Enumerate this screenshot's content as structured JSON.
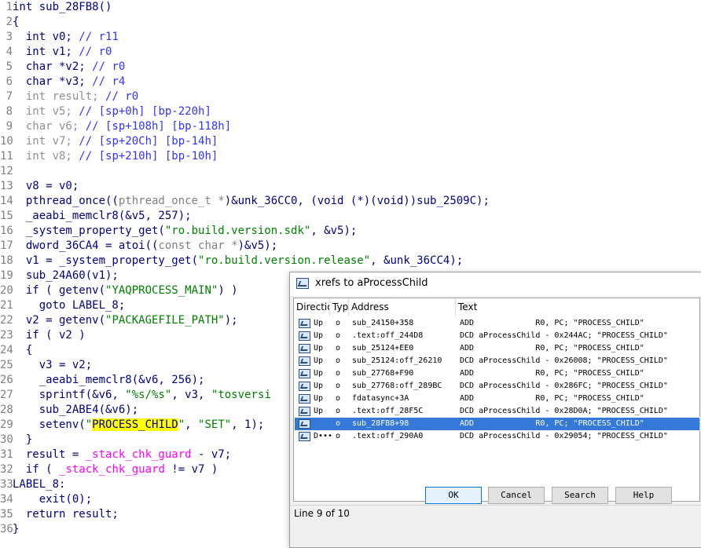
{
  "code_lines": [
    {
      "n": "1",
      "tokens": [
        {
          "t": "int ",
          "c": "kw"
        },
        {
          "t": "sub_28FB8",
          "c": "kw"
        },
        {
          "t": "()",
          "c": "kw"
        }
      ]
    },
    {
      "n": "2",
      "tokens": [
        {
          "t": "{",
          "c": "punc"
        }
      ]
    },
    {
      "n": "3",
      "tokens": [
        {
          "t": "  int v0; ",
          "c": "var"
        },
        {
          "t": "// r11",
          "c": "cmt"
        }
      ]
    },
    {
      "n": "4",
      "tokens": [
        {
          "t": "  int v1; ",
          "c": "var"
        },
        {
          "t": "// r0",
          "c": "cmt"
        }
      ]
    },
    {
      "n": "5",
      "tokens": [
        {
          "t": "  char *v2; ",
          "c": "var"
        },
        {
          "t": "// r0",
          "c": "cmt"
        }
      ]
    },
    {
      "n": "6",
      "tokens": [
        {
          "t": "  char *v3; ",
          "c": "var"
        },
        {
          "t": "// r4",
          "c": "cmt"
        }
      ]
    },
    {
      "n": "7",
      "tokens": [
        {
          "t": "  int result; ",
          "c": "gray"
        },
        {
          "t": "// r0",
          "c": "cmt"
        }
      ]
    },
    {
      "n": "8",
      "tokens": [
        {
          "t": "  int v5; ",
          "c": "gray"
        },
        {
          "t": "// [sp+0h] [bp-220h]",
          "c": "cmt"
        }
      ]
    },
    {
      "n": "9",
      "tokens": [
        {
          "t": "  char v6; ",
          "c": "gray"
        },
        {
          "t": "// [sp+108h] [bp-118h]",
          "c": "cmt"
        }
      ]
    },
    {
      "n": "10",
      "tokens": [
        {
          "t": "  int v7; ",
          "c": "gray"
        },
        {
          "t": "// [sp+20Ch] [bp-14h]",
          "c": "cmt"
        }
      ]
    },
    {
      "n": "11",
      "tokens": [
        {
          "t": "  int v8; ",
          "c": "gray"
        },
        {
          "t": "// [sp+210h] [bp-10h]",
          "c": "cmt"
        }
      ]
    },
    {
      "n": "12",
      "tokens": []
    },
    {
      "n": "13",
      "tokens": [
        {
          "t": "  v8 = v0;",
          "c": "var"
        }
      ]
    },
    {
      "n": "14",
      "tokens": [
        {
          "t": "  pthread_once((",
          "c": "name"
        },
        {
          "t": "pthread_once_t *",
          "c": "dim"
        },
        {
          "t": ")&unk_36CC0, (",
          "c": "name"
        },
        {
          "t": "void (*)(void)",
          "c": "name"
        },
        {
          "t": ")sub_2509C);",
          "c": "name"
        }
      ]
    },
    {
      "n": "15",
      "tokens": [
        {
          "t": "  _aeabi_memclr8(&v5, 257);",
          "c": "name"
        }
      ]
    },
    {
      "n": "16",
      "tokens": [
        {
          "t": "  _system_property_get(",
          "c": "name"
        },
        {
          "t": "\"ro.build.version.sdk\"",
          "c": "str"
        },
        {
          "t": ", &v5);",
          "c": "name"
        }
      ]
    },
    {
      "n": "17",
      "tokens": [
        {
          "t": "  dword_36CA4 = atoi((",
          "c": "name"
        },
        {
          "t": "const char *",
          "c": "dim"
        },
        {
          "t": ")&v5);",
          "c": "name"
        }
      ]
    },
    {
      "n": "18",
      "tokens": [
        {
          "t": "  v1 = _system_property_get(",
          "c": "name"
        },
        {
          "t": "\"ro.build.version.release\"",
          "c": "str"
        },
        {
          "t": ", &unk_36CC4);",
          "c": "name"
        }
      ]
    },
    {
      "n": "19",
      "tokens": [
        {
          "t": "  sub_24A60(v1);",
          "c": "name"
        }
      ]
    },
    {
      "n": "20",
      "tokens": [
        {
          "t": "  if ( getenv(",
          "c": "name"
        },
        {
          "t": "\"YAQPROCESS_MAIN\"",
          "c": "str"
        },
        {
          "t": ") )",
          "c": "name"
        }
      ]
    },
    {
      "n": "21",
      "tokens": [
        {
          "t": "    goto LABEL_8;",
          "c": "name"
        }
      ]
    },
    {
      "n": "22",
      "tokens": [
        {
          "t": "  v2 = getenv(",
          "c": "name"
        },
        {
          "t": "\"PACKAGEFILE_PATH\"",
          "c": "str"
        },
        {
          "t": ");",
          "c": "name"
        }
      ]
    },
    {
      "n": "23",
      "tokens": [
        {
          "t": "  if ( v2 )",
          "c": "name"
        }
      ]
    },
    {
      "n": "24",
      "tokens": [
        {
          "t": "  {",
          "c": "punc"
        }
      ]
    },
    {
      "n": "25",
      "tokens": [
        {
          "t": "    v3 = v2;",
          "c": "name"
        }
      ]
    },
    {
      "n": "26",
      "tokens": [
        {
          "t": "    _aeabi_memclr8(&v6, 256);",
          "c": "name"
        }
      ]
    },
    {
      "n": "27",
      "tokens": [
        {
          "t": "    sprintf(&v6, ",
          "c": "name"
        },
        {
          "t": "\"%s/%s\"",
          "c": "str"
        },
        {
          "t": ", v3, ",
          "c": "name"
        },
        {
          "t": "\"tosversi",
          "c": "str"
        }
      ]
    },
    {
      "n": "28",
      "tokens": [
        {
          "t": "    sub_2ABE4(&v6);",
          "c": "name"
        }
      ]
    },
    {
      "n": "29",
      "tokens": [
        {
          "t": "    setenv(",
          "c": "name"
        },
        {
          "t": "\"",
          "c": "str"
        },
        {
          "t": "PROCESS_CHILD",
          "c": "strhl"
        },
        {
          "t": "\"",
          "c": "str"
        },
        {
          "t": ", ",
          "c": "name"
        },
        {
          "t": "\"SET\"",
          "c": "str"
        },
        {
          "t": ", 1);",
          "c": "name"
        }
      ]
    },
    {
      "n": "30",
      "tokens": [
        {
          "t": "  }",
          "c": "punc"
        }
      ]
    },
    {
      "n": "31",
      "tokens": [
        {
          "t": "  result = ",
          "c": "name"
        },
        {
          "t": "_stack_chk_guard",
          "c": "lib"
        },
        {
          "t": " - v7;",
          "c": "name"
        }
      ]
    },
    {
      "n": "32",
      "tokens": [
        {
          "t": "  if ( ",
          "c": "name"
        },
        {
          "t": "_stack_chk_guard",
          "c": "lib"
        },
        {
          "t": " != v7 )",
          "c": "name"
        }
      ]
    },
    {
      "n": "33",
      "tokens": [
        {
          "t": "LABEL_8:",
          "c": "name"
        }
      ]
    },
    {
      "n": "34",
      "tokens": [
        {
          "t": "    exit(0);",
          "c": "name"
        }
      ]
    },
    {
      "n": "35",
      "tokens": [
        {
          "t": "  return result;",
          "c": "name"
        }
      ]
    },
    {
      "n": "36",
      "tokens": [
        {
          "t": "}",
          "c": "punc"
        }
      ]
    }
  ],
  "dialog": {
    "title": "xrefs to aProcessChild",
    "columns": {
      "direction": "Directio",
      "type": "Typ",
      "address": "Address",
      "text": "Text"
    },
    "rows": [
      {
        "dir": "Up",
        "type": "o",
        "address": "sub_24150+358",
        "text": "ADD             R0, PC; \"PROCESS_CHILD\""
      },
      {
        "dir": "Up",
        "type": "o",
        "address": ".text:off_244D8",
        "text": "DCD aProcessChild - 0x244AC; \"PROCESS_CHILD\""
      },
      {
        "dir": "Up",
        "type": "o",
        "address": "sub_25124+EE0",
        "text": "ADD             R0, PC; \"PROCESS_CHILD\""
      },
      {
        "dir": "Up",
        "type": "o",
        "address": "sub_25124:off_26210",
        "text": "DCD aProcessChild - 0x26008; \"PROCESS_CHILD\""
      },
      {
        "dir": "Up",
        "type": "o",
        "address": "sub_27768+F90",
        "text": "ADD             R0, PC; \"PROCESS_CHILD\""
      },
      {
        "dir": "Up",
        "type": "o",
        "address": "sub_27768:off_289BC",
        "text": "DCD aProcessChild - 0x286FC; \"PROCESS_CHILD\""
      },
      {
        "dir": "Up",
        "type": "o",
        "address": "fdatasync+3A",
        "text": "ADD             R0, PC; \"PROCESS_CHILD\""
      },
      {
        "dir": "Up",
        "type": "o",
        "address": ".text:off_28F5C",
        "text": "DCD aProcessChild - 0x28D0A; \"PROCESS_CHILD\""
      },
      {
        "dir": "",
        "type": "o",
        "address": "sub_28FB8+98",
        "text": "ADD             R0, PC; \"PROCESS_CHILD\"",
        "selected": true
      },
      {
        "dir": "D•••",
        "type": "o",
        "address": ".text:off_290A0",
        "text": "DCD aProcessChild - 0x29054; \"PROCESS_CHILD\""
      }
    ],
    "buttons": {
      "ok": "OK",
      "cancel": "Cancel",
      "search": "Search",
      "help": "Help"
    },
    "status": "Line 9 of 10"
  }
}
